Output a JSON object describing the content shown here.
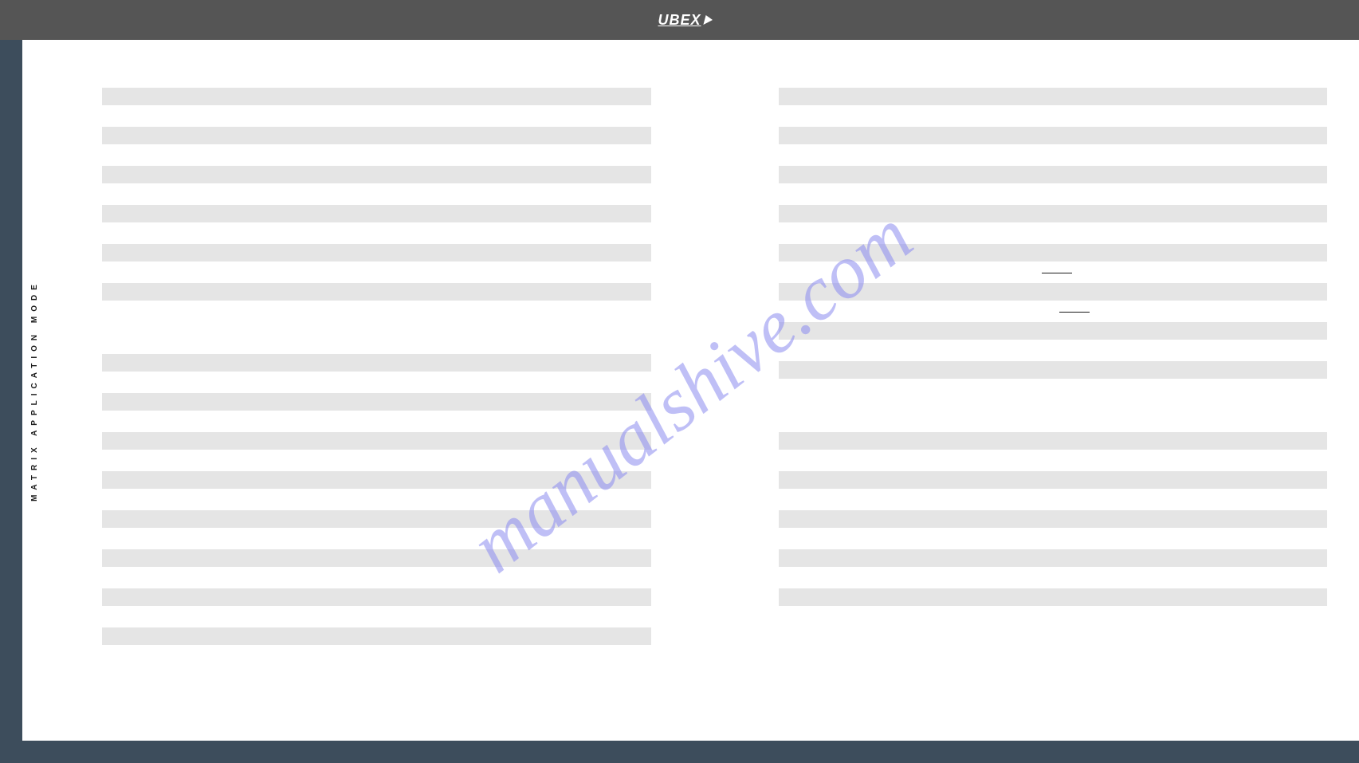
{
  "header": {
    "brand": "UBEX"
  },
  "sidebar": {
    "label": "MATRIX APPLICATION MODE"
  },
  "watermark": "manualshive.com",
  "left_column": {
    "group1_count": 6,
    "group2_count": 8
  },
  "right_column": {
    "group1_count": 8,
    "group2_count": 5,
    "underlines": [
      {
        "after_bar_index": 5
      },
      {
        "after_bar_index": 6
      }
    ]
  }
}
